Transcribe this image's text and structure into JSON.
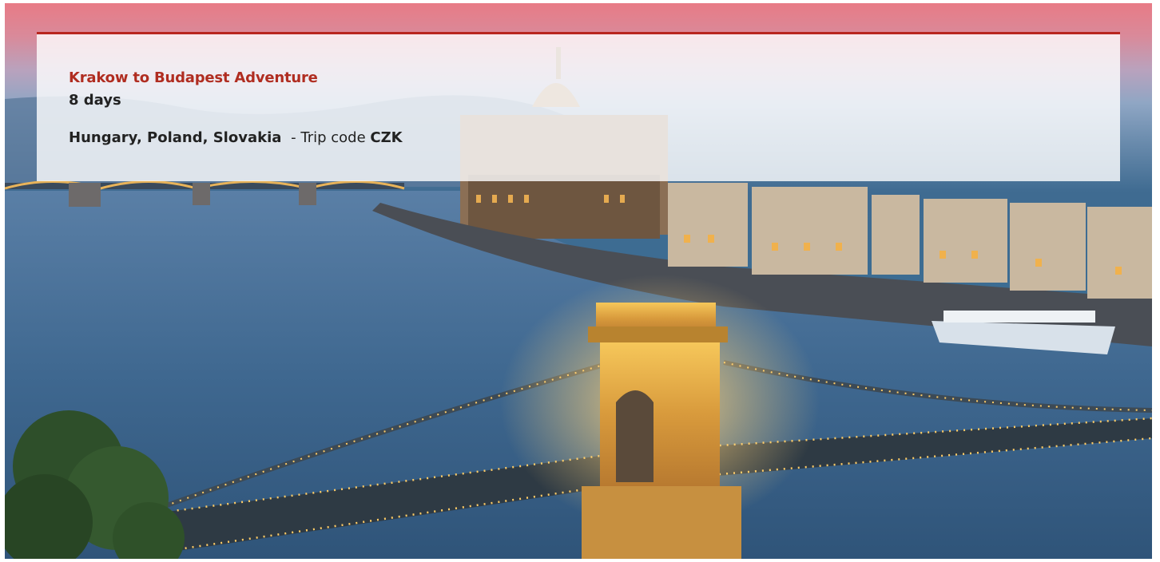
{
  "trip": {
    "title": "Krakow to Budapest Adventure",
    "duration": "8 days",
    "countries": "Hungary, Poland, Slovakia",
    "trip_code_label": "- Trip code",
    "trip_code": "CZK"
  },
  "colors": {
    "accent": "#b02d21",
    "panel_border": "#b8261f",
    "text": "#222222"
  }
}
